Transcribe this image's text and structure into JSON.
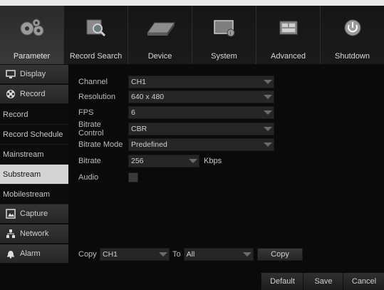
{
  "topnav": {
    "tabs": [
      {
        "label": "Parameter",
        "icon": "gears-icon"
      },
      {
        "label": "Record Search",
        "icon": "magnifier-icon"
      },
      {
        "label": "Device",
        "icon": "hard-drive-icon"
      },
      {
        "label": "System",
        "icon": "monitor-info-icon"
      },
      {
        "label": "Advanced",
        "icon": "advanced-panel-icon"
      },
      {
        "label": "Shutdown",
        "icon": "power-icon"
      }
    ]
  },
  "sidebar": {
    "display": "Display",
    "record": "Record",
    "record_sub": [
      "Record",
      "Record Schedule",
      "Mainstream",
      "Substream",
      "Mobilestream"
    ],
    "capture": "Capture",
    "network": "Network",
    "alarm": "Alarm"
  },
  "form": {
    "channel": {
      "label": "Channel",
      "value": "CH1"
    },
    "resolution": {
      "label": "Resolution",
      "value": "640 x 480"
    },
    "fps": {
      "label": "FPS",
      "value": "6"
    },
    "bitrate_control": {
      "label": "Bitrate Control",
      "value": "CBR"
    },
    "bitrate_mode": {
      "label": "Bitrate Mode",
      "value": "Predefined"
    },
    "bitrate": {
      "label": "Bitrate",
      "value": "256",
      "unit": "Kbps"
    },
    "audio": {
      "label": "Audio",
      "checked": false
    }
  },
  "copy": {
    "label": "Copy",
    "from": "CH1",
    "to_label": "To",
    "to": "All",
    "button": "Copy"
  },
  "footer": {
    "default": "Default",
    "save": "Save",
    "cancel": "Cancel"
  },
  "colors": {
    "active_subitem": "#d4d4d4",
    "background": "#0a0a0a"
  }
}
